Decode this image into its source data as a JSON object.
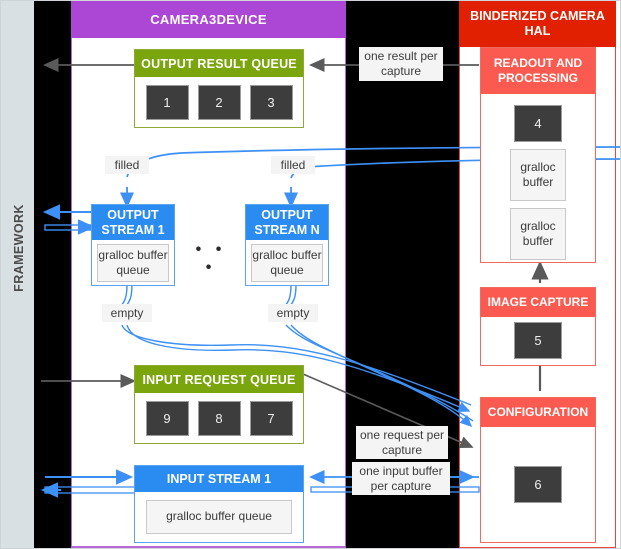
{
  "columns": {
    "framework": {
      "label": "FRAMEWORK"
    },
    "device": {
      "title": "CAMERA3DEVICE"
    },
    "hal": {
      "title": "BINDERIZED CAMERA HAL"
    }
  },
  "device": {
    "output_result_queue": {
      "title": "OUTPUT RESULT QUEUE",
      "chips": [
        "1",
        "2",
        "3"
      ]
    },
    "input_request_queue": {
      "title": "INPUT REQUEST QUEUE",
      "chips": [
        "9",
        "8",
        "7"
      ]
    },
    "output_stream_1": {
      "title": "OUTPUT STREAM 1",
      "buffer": "gralloc buffer queue"
    },
    "output_stream_n": {
      "title": "OUTPUT STREAM N",
      "buffer": "gralloc buffer queue"
    },
    "input_stream_1": {
      "title": "INPUT STREAM 1",
      "buffer": "gralloc buffer queue"
    },
    "ellipsis": "• • •"
  },
  "hal": {
    "readout": {
      "title": "READOUT AND PROCESSING",
      "chip": "4",
      "buffers": [
        "gralloc buffer",
        "gralloc buffer"
      ]
    },
    "image_capture": {
      "title": "IMAGE CAPTURE",
      "chip": "5"
    },
    "configuration": {
      "title": "CONFIGURATION",
      "chip": "6"
    }
  },
  "labels": {
    "filled_1": "filled",
    "filled_n": "filled",
    "empty_1": "empty",
    "empty_n": "empty",
    "one_result_per_capture": "one result per capture",
    "one_request_per_capture": "one request per capture",
    "one_input_buffer_per_capture": "one input buffer per capture"
  },
  "colors": {
    "framework_strip": "#d9e0e3",
    "device_header": "#ab47d4",
    "hal_header": "#e02000",
    "queue_header": "#7ba50d",
    "stream_header": "#2a8cf0",
    "hal_box_header": "#fa5a4f",
    "chip": "#3d3d3d",
    "blue_arrow": "#3d90f5",
    "gray_arrow": "#5a5a5a"
  }
}
